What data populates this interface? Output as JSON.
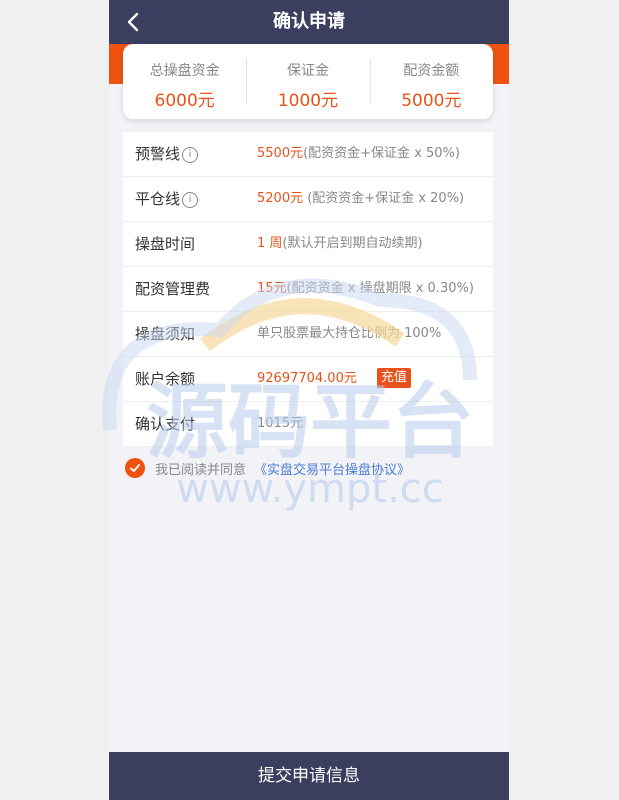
{
  "header": {
    "title": "确认申请",
    "back_icon": "chevron-left-icon"
  },
  "summary": [
    {
      "label": "总操盘资金",
      "value": "6000元"
    },
    {
      "label": "保证金",
      "value": "1000元"
    },
    {
      "label": "配资金额",
      "value": "5000元"
    }
  ],
  "rows": {
    "warning": {
      "label": "预警线",
      "info": "i",
      "value": "5500元",
      "note": "(配资资金+保证金 x 50%)"
    },
    "closeout": {
      "label": "平仓线",
      "info": "i",
      "value": "5200元",
      "note": " (配资资金+保证金 x 20%)"
    },
    "duration": {
      "label": "操盘时间",
      "value": "1 周",
      "note": "(默认开启到期自动续期)"
    },
    "fee": {
      "label": "配资管理费",
      "value": "15元",
      "note": "(配资资金 x 操盘期限 x 0.30%)"
    },
    "notice": {
      "label": "操盘须知",
      "note": "单只股票最大持仓比例为 100%"
    },
    "balance": {
      "label": "账户余额",
      "value": "92697704.00元",
      "recharge": "充值"
    },
    "pay": {
      "label": "确认支付",
      "note": "1015元"
    }
  },
  "agreement": {
    "checked": true,
    "text": "我已阅读并同意",
    "link": "《实盘交易平台操盘协议》"
  },
  "watermark": {
    "title": "源码平台",
    "url": "www.ympt.cc"
  },
  "submit": {
    "label": "提交申请信息"
  },
  "colors": {
    "header": "#3b3e5e",
    "accent": "#f0520f",
    "link": "#4a7fd6"
  }
}
